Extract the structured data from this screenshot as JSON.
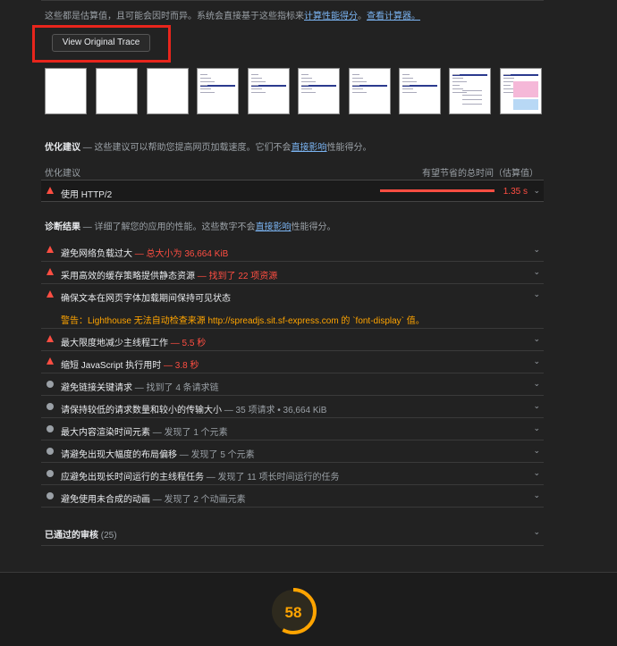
{
  "notice": {
    "text": "这些都是估算值，且可能会因时而异。系统会直接基于这些指标来",
    "link1": "计算性能得分",
    "sep": "。",
    "link2": "查看计算器。"
  },
  "trace_button": "View Original Trace",
  "opportunities": {
    "title": "优化建议",
    "desc": " — 这些建议可以帮助您提高网页加载速度。它们不会",
    "link": "直接影响",
    "desc2": "性能得分。",
    "col_left": "优化建议",
    "col_right": "有望节省的总时间（估算值）",
    "items": [
      {
        "label": "使用 HTTP/2",
        "savings": "1.35 s"
      }
    ]
  },
  "diagnostics": {
    "title": "诊断结果",
    "desc": " — 详细了解您的应用的性能。这些数字不会",
    "link": "直接影响",
    "desc2": "性能得分。",
    "warn_items": [
      {
        "label": "避免网络负载过大",
        "detail": " — 总大小为 36,664 KiB"
      },
      {
        "label": "采用高效的缓存策略提供静态资源",
        "detail": " — 找到了 22 项资源"
      },
      {
        "label": "确保文本在网页字体加载期间保持可见状态",
        "detail": ""
      },
      {
        "label": "最大限度地减少主线程工作",
        "detail": " — 5.5 秒"
      },
      {
        "label": "缩短 JavaScript 执行用时",
        "detail": " — 3.8 秒"
      }
    ],
    "warning_text": "警告：Lighthouse 无法自动检查来源 http://spreadjs.sit.sf-express.com 的 `font-display` 值。",
    "info_items": [
      {
        "label": "避免链接关键请求",
        "detail": " — 找到了 4 条请求链"
      },
      {
        "label": "请保持较低的请求数量和较小的传输大小",
        "detail": " — 35 项请求 • 36,664 KiB"
      },
      {
        "label": "最大内容渲染时间元素",
        "detail": " — 发现了 1 个元素"
      },
      {
        "label": "请避免出现大幅度的布局偏移",
        "detail": " — 发现了 5 个元素"
      },
      {
        "label": "应避免出现长时间运行的主线程任务",
        "detail": " — 发现了 11 项长时间运行的任务"
      },
      {
        "label": "避免使用未合成的动画",
        "detail": " — 发现了 2 个动画元素"
      }
    ]
  },
  "passed": {
    "label": "已通过的审核",
    "count": "(25)"
  },
  "score": {
    "value": "58",
    "fraction": 0.58,
    "color": "#ffa400"
  },
  "colors": {
    "fail": "#ff4e42",
    "average": "#ffa400",
    "link": "#7bb4f2"
  }
}
